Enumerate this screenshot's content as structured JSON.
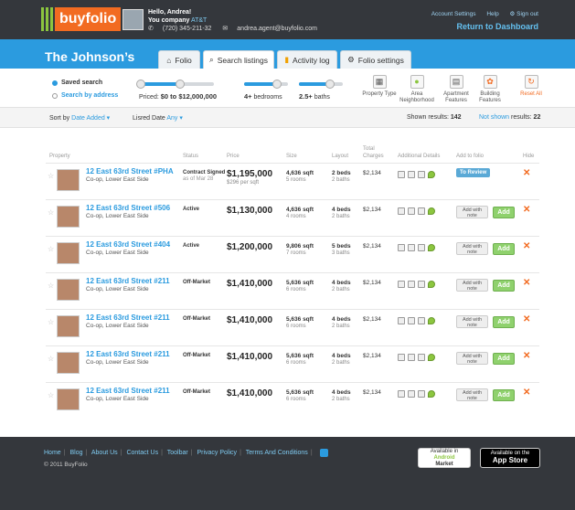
{
  "brand": {
    "logo": "buyfolio"
  },
  "user": {
    "greeting": "Hello, Andrea!",
    "company_prefix": "You company",
    "company": "AT&T",
    "phone": "(720) 345-211-32",
    "email": "andrea.agent@buyfolio.com"
  },
  "top_links": {
    "account": "Account Settings",
    "help": "Help",
    "signout": "Sign out",
    "dashboard": "Return to Dashboard"
  },
  "folio": {
    "name": "The Johnson’s"
  },
  "tabs": [
    {
      "label": "Folio",
      "icon": "home-icon"
    },
    {
      "label": "Search listings",
      "icon": "search-icon"
    },
    {
      "label": "Activity log",
      "icon": "folder-icon"
    },
    {
      "label": "Folio settings",
      "icon": "gear-icon"
    }
  ],
  "filters": {
    "saved": "Saved search",
    "by_address": "Search by address",
    "price_prefix": "Priced:",
    "price_range": "$0 to $12,000,000",
    "bedrooms_value": "4+",
    "bedrooms_label": "bedrooms",
    "baths_value": "2.5+",
    "baths_label": "baths",
    "price_fill": [
      0.0,
      0.55
    ],
    "bed_fill": 0.75,
    "bath_fill": 0.7,
    "icons": [
      {
        "label": "Property Type",
        "icon": "building-icon"
      },
      {
        "label": "Area Neighborhood",
        "icon": "map-pin-icon"
      },
      {
        "label": "Apartment Features",
        "icon": "grid-icon"
      },
      {
        "label": "Building Features",
        "icon": "paw-icon"
      },
      {
        "label": "Reset All",
        "icon": "refresh-icon"
      }
    ]
  },
  "sort": {
    "sort_label": "Sort by",
    "sort_value": "Date Added",
    "listed_label": "Lisred Date",
    "listed_value": "Any",
    "shown_label": "Shown results:",
    "shown_count": "142",
    "notshown_label": "Not shown",
    "notshown_suffix": "results:",
    "notshown_count": "22"
  },
  "columns": {
    "property": "Property",
    "status": "Status",
    "price": "Price",
    "size": "Size",
    "layout": "Layout",
    "charges_1": "Total",
    "charges_2": "Charges",
    "details": "Additional Details",
    "add": "Add to folio",
    "hide": "Hide"
  },
  "listings": [
    {
      "address": "12 East 63rd Street #PHA",
      "area": "Co-op, Lower East Side",
      "status": "Contract Signed",
      "status_note": "as of Mar 28",
      "price": "$1,195,000",
      "ppsf": "$296 per sqft",
      "size": "4,636 sqft",
      "rooms": "5 rooms",
      "beds": "2 beds",
      "baths": "2 baths",
      "charges": "$2,134",
      "action": "To Review"
    },
    {
      "address": "12 East 63rd Street #506",
      "area": "Co-op, Lower East Side",
      "status": "Active",
      "status_note": "",
      "price": "$1,130,000",
      "ppsf": "",
      "size": "4,636 sqft",
      "rooms": "4 rooms",
      "beds": "4 beds",
      "baths": "2 baths",
      "charges": "$2,134",
      "action": "Add"
    },
    {
      "address": "12 East 63rd Street #404",
      "area": "Co-op, Lower East Side",
      "status": "Active",
      "status_note": "",
      "price": "$1,200,000",
      "ppsf": "",
      "size": "9,806 sqft",
      "rooms": "7 rooms",
      "beds": "5 beds",
      "baths": "3 baths",
      "charges": "$2,134",
      "action": "Add"
    },
    {
      "address": "12 East 63rd Street #211",
      "area": "Co-op, Lower East Side",
      "status": "Off-Market",
      "status_note": "",
      "price": "$1,410,000",
      "ppsf": "",
      "size": "5,636 sqft",
      "rooms": "6 rooms",
      "beds": "4 beds",
      "baths": "2 baths",
      "charges": "$2,134",
      "action": "Add"
    },
    {
      "address": "12 East 63rd Street #211",
      "area": "Co-op, Lower East Side",
      "status": "Off-Market",
      "status_note": "",
      "price": "$1,410,000",
      "ppsf": "",
      "size": "5,636 sqft",
      "rooms": "6 rooms",
      "beds": "4 beds",
      "baths": "2 baths",
      "charges": "$2,134",
      "action": "Add"
    },
    {
      "address": "12 East 63rd Street #211",
      "area": "Co-op, Lower East Side",
      "status": "Off-Market",
      "status_note": "",
      "price": "$1,410,000",
      "ppsf": "",
      "size": "5,636 sqft",
      "rooms": "6 rooms",
      "beds": "4 beds",
      "baths": "2 baths",
      "charges": "$2,134",
      "action": "Add"
    },
    {
      "address": "12 East 63rd Street #211",
      "area": "Co-op, Lower East Side",
      "status": "Off-Market",
      "status_note": "",
      "price": "$1,410,000",
      "ppsf": "",
      "size": "5,636 sqft",
      "rooms": "6 rooms",
      "beds": "4 beds",
      "baths": "2 baths",
      "charges": "$2,134",
      "action": "Add"
    }
  ],
  "row_labels": {
    "add_note": "Add with note",
    "add": "Add",
    "hide": "✕"
  },
  "footer": {
    "links": [
      "Home",
      "Blog",
      "About Us",
      "Contact Us",
      "Toolbar",
      "Privacy Policy",
      "Terms And Conditions"
    ],
    "copyright": "© 2011 BuyFolio",
    "android_1": "Available in",
    "android_2": "Android",
    "android_3": "Market",
    "apple_1": "Available on the",
    "apple_2": "App Store"
  },
  "colors": {
    "accent": "#2b9bdf",
    "brand_orange": "#f26b21",
    "brand_green": "#8cc63f",
    "dark": "#34373c"
  }
}
